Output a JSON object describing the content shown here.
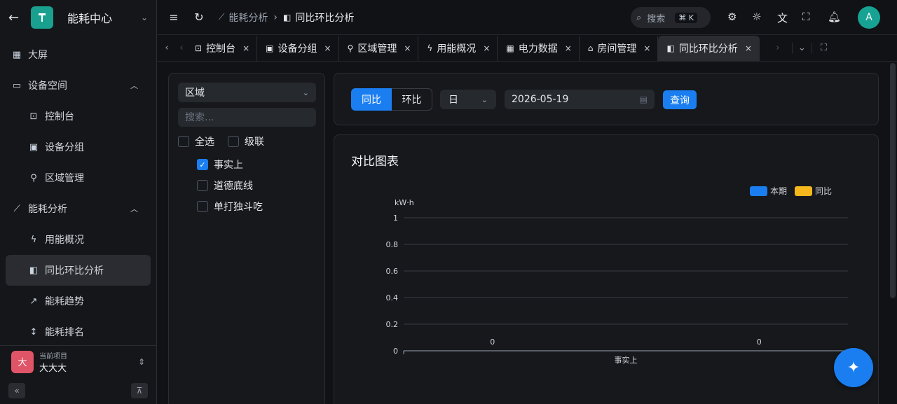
{
  "sidebar": {
    "app_title": "能耗中心",
    "items": [
      {
        "label": "大屏",
        "icon": "dashboard-icon"
      },
      {
        "label": "设备空间",
        "icon": "device-icon"
      },
      {
        "label": "控制台",
        "icon": "console-icon"
      },
      {
        "label": "设备分组",
        "icon": "group-icon"
      },
      {
        "label": "区域管理",
        "icon": "location-icon"
      },
      {
        "label": "能耗分析",
        "icon": "chart-icon"
      },
      {
        "label": "用能概况",
        "icon": "bolt-icon"
      },
      {
        "label": "同比环比分析",
        "icon": "compare-icon"
      },
      {
        "label": "能耗趋势",
        "icon": "trend-icon"
      },
      {
        "label": "能耗排名",
        "icon": "rank-icon"
      }
    ],
    "project_caption": "当前项目",
    "project_name": "大大大",
    "project_avatar": "大"
  },
  "header": {
    "breadcrumb": [
      "能耗分析",
      "同比环比分析"
    ],
    "search_placeholder": "搜索",
    "search_kbd": "⌘ K",
    "avatar_letter": "A"
  },
  "tabs": [
    {
      "label": "控制台",
      "icon": "console-icon",
      "active": false
    },
    {
      "label": "设备分组",
      "icon": "group-icon",
      "active": false
    },
    {
      "label": "区域管理",
      "icon": "location-icon",
      "active": false
    },
    {
      "label": "用能概况",
      "icon": "bolt-icon",
      "active": false
    },
    {
      "label": "电力数据",
      "icon": "table-icon",
      "active": false
    },
    {
      "label": "房间管理",
      "icon": "house-icon",
      "active": false
    },
    {
      "label": "同比环比分析",
      "icon": "compare-icon",
      "active": true
    }
  ],
  "left_panel": {
    "region_select": "区域",
    "search_placeholder": "搜索...",
    "select_all": "全选",
    "cascade": "级联",
    "tree": [
      {
        "label": "事实上",
        "checked": true
      },
      {
        "label": "道德底线",
        "checked": false
      },
      {
        "label": "单打独斗吃",
        "checked": false
      }
    ]
  },
  "filter": {
    "yoy": "同比",
    "mom": "环比",
    "period": "日",
    "date": "2026-05-19",
    "query": "查询"
  },
  "chart_data": {
    "type": "bar",
    "title": "对比图表",
    "ylabel": "kW·h",
    "categories": [
      "事实上"
    ],
    "series": [
      {
        "name": "本期",
        "values": [
          0
        ],
        "color": "#1a7ef0"
      },
      {
        "name": "同比",
        "values": [
          0
        ],
        "color": "#f4b81c"
      }
    ],
    "ylim": [
      0,
      1
    ],
    "yticks": [
      "1",
      "0.8",
      "0.6",
      "0.4",
      "0.2",
      "0"
    ],
    "legend": "top-right"
  }
}
